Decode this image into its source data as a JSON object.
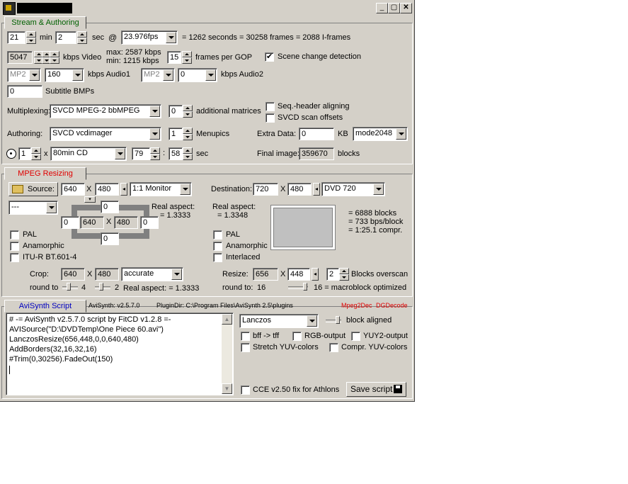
{
  "window": {
    "title": ""
  },
  "stream": {
    "tab": "Stream & Authoring",
    "min": "21",
    "min_label": "min",
    "sec": "2",
    "sec_label": "sec",
    "at": "@",
    "fps": "23.976fps",
    "summary": "= 1262 seconds = 30258 frames = 2088 I-frames",
    "video_kbps": "5047",
    "video_label": "kbps Video",
    "maxmin": "max:  2587 kbps\nmin:   1215 kbps",
    "max_line": "max:  2587 kbps",
    "min_line": "min:   1215 kbps",
    "gop": "15",
    "gop_label": "frames per GOP",
    "scene_label": "Scene change detection",
    "audio1_codec": "MP2",
    "audio1_kbps": "160",
    "audio1_label": "kbps Audio1",
    "audio2_codec": "MP2",
    "audio2_kbps": "0",
    "audio2_label": "kbps Audio2",
    "subtitle": "0",
    "subtitle_label": "Subtitle BMPs",
    "mux_label": "Multiplexing:",
    "mux": "SVCD MPEG-2 bbMPEG",
    "matrices": "0",
    "matrices_label": "additional matrices",
    "seq_label": "Seq.-header aligning",
    "svcd_label": "SVCD scan offsets",
    "auth_label": "Authoring:",
    "auth": "SVCD vcdimager",
    "menupics": "1",
    "menupics_label": "Menupics",
    "extra_label": "Extra Data:",
    "extra": "0",
    "kb": "KB",
    "mode": "mode2048",
    "discs": "1",
    "x": "x",
    "disc_type": "80min CD",
    "disc_min": "79",
    "colon": ":",
    "disc_sec": "58",
    "disc_sec_label": "sec",
    "final_label": "Final image:",
    "final": "359670",
    "blocks": "blocks"
  },
  "resize": {
    "tab": "MPEG Resizing",
    "source_label": "Source:",
    "src_w": "640",
    "x": "X",
    "src_h": "480",
    "monitor": "1:1 Monitor",
    "dest_label": "Destination:",
    "dst_w": "720",
    "dst_h": "480",
    "dest_preset": "DVD 720",
    "left_combo": "---",
    "top": "0",
    "left": "0",
    "inner_w": "640",
    "inner_h": "480",
    "right": "0",
    "bottom": "0",
    "real_aspect_label": "Real aspect:",
    "real_aspect_src": "= 1.3333",
    "real_aspect_dst_label": "Real aspect:",
    "real_aspect_dst": "= 1.3348",
    "stats1": "= 6888 blocks",
    "stats2": "= 733 bps/block",
    "stats3": "= 1:25.1 compr.",
    "pal": "PAL",
    "anamorphic": "Anamorphic",
    "itu": "ITU-R BT.601-4",
    "pal2": "PAL",
    "anamorphic2": "Anamorphic",
    "interlaced": "Interlaced",
    "crop_label": "Crop:",
    "crop_w": "640",
    "crop_h": "480",
    "crop_mode": "accurate",
    "roundto_label": "round to",
    "round_a": "4",
    "round_b": "2",
    "real_aspect_crop": "Real aspect: = 1.3333",
    "resize_label": "Resize:",
    "res_w": "656",
    "res_h": "448",
    "overscan": "2",
    "overscan_label": "Blocks overscan",
    "roundto2_label": "round to:",
    "round_c": "16",
    "macro": "16  = macroblock optimized"
  },
  "avisynth": {
    "tab": "AviSynth Script",
    "version": "AviSynth:  v2.5.7.0",
    "plugindir": "PluginDir:  C:\\Program Files\\AviSynth 2.5\\plugins",
    "mpeg2dec": "Mpeg2Dec",
    "dgdecode": "DGDecode",
    "script": [
      "# -= AviSynth v2.5.7.0 script by FitCD v1.2.8 =-",
      "AVISource(\"D:\\DVDTemp\\One Piece 60.avi\")",
      "LanczosResize(656,448,0,0,640,480)",
      "AddBorders(32,16,32,16)",
      "#Trim(0,30256).FadeOut(150)"
    ],
    "resizer": "Lanczos",
    "block_aligned": "block aligned",
    "bff": "bff -> tff",
    "rgb": "RGB-output",
    "yuy2": "YUY2-output",
    "stretch": "Stretch YUV-colors",
    "compr": "Compr. YUV-colors",
    "cce": "CCE v2.50 fix for Athlons",
    "save": "Save script"
  },
  "colors": {
    "accent_tab": "#0000c0",
    "red_tab": "#e00000",
    "green_tab": "#006000"
  }
}
